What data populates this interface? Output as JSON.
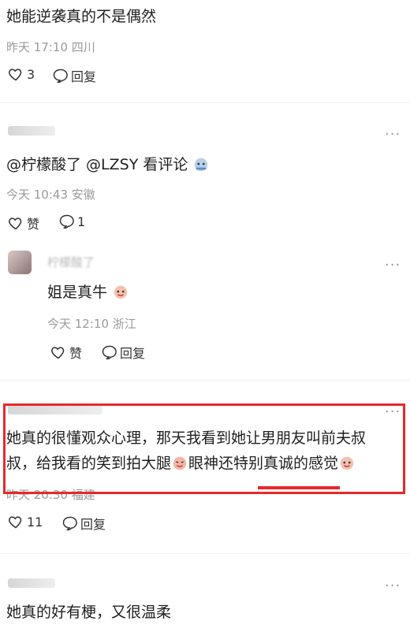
{
  "c1": {
    "text": "她能逆袭真的不是偶然",
    "meta": "昨天 17:10 四川",
    "likes": "3",
    "reply": "回复"
  },
  "c2": {
    "user": "",
    "text": "@柠檬酸了 @LZSY 看评论",
    "meta": "今天 10:43 安徽",
    "like": "赞",
    "comments": "1"
  },
  "c2r": {
    "user": "柠檬酸了",
    "text": "姐是真牛",
    "meta": "今天 12:10 浙江",
    "like": "赞",
    "reply": "回复"
  },
  "c3": {
    "user": "",
    "line1": "她真的很懂观众心理，那天我看到她让男朋友叫前夫叔",
    "line2": "叔，给我看的笑到拍大腿",
    "line2b": "眼神还特别真诚的感觉",
    "meta": "昨天 20:30 福建",
    "likes": "11",
    "reply": "回复"
  },
  "c4": {
    "user": "",
    "text": "她真的好有梗，又很温柔"
  },
  "more": "···",
  "colors": {
    "highlight": "#e8282b",
    "meta": "#9a9a9a"
  }
}
